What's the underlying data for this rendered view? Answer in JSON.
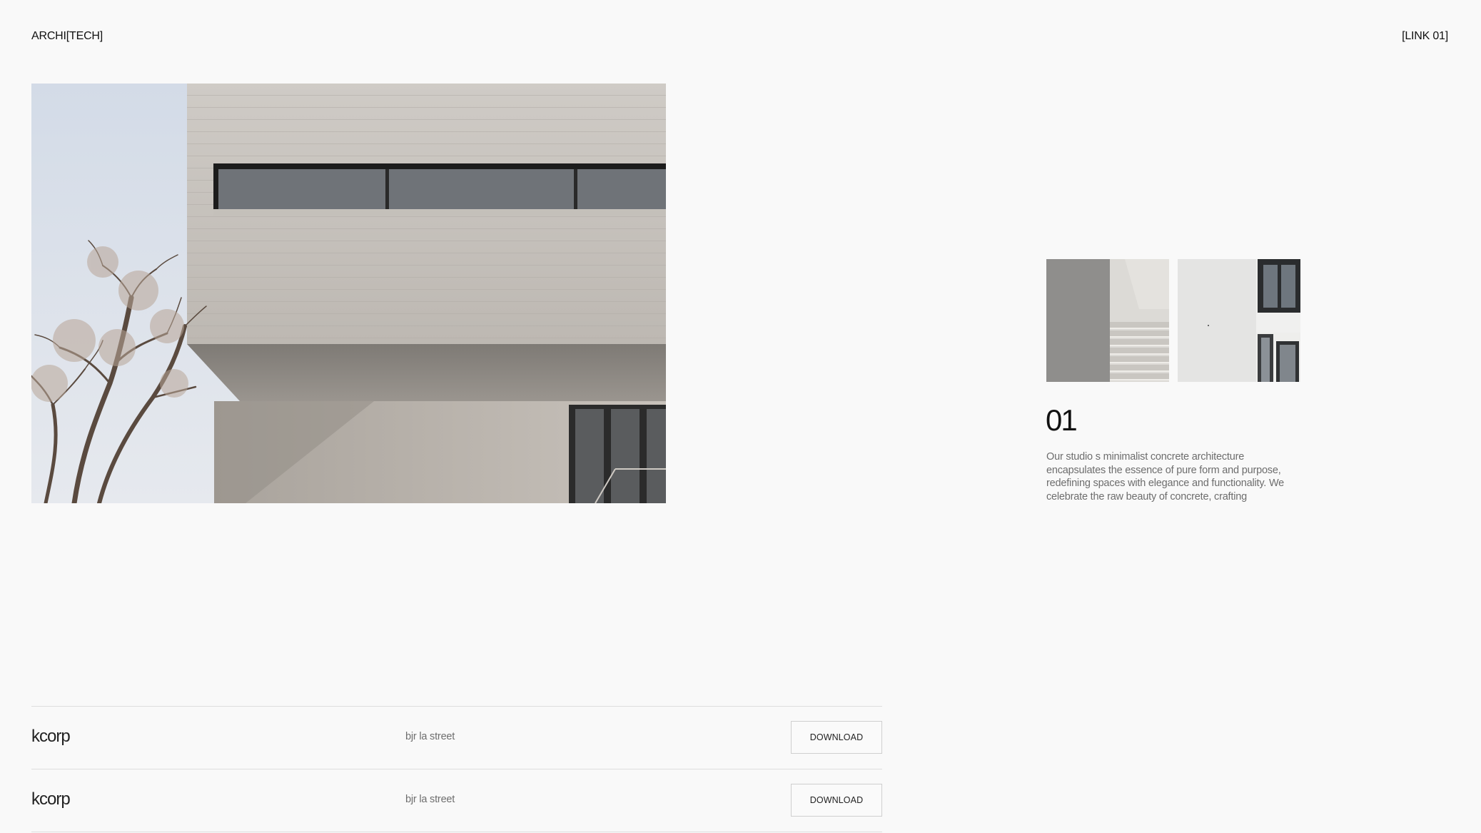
{
  "header": {
    "logo": "ARCHI[TECH]",
    "nav_link": "[LINK 01]"
  },
  "hero": {
    "icon": "architecture-photo"
  },
  "project": {
    "number": "01",
    "description": "Our studio s minimalist concrete architecture encapsulates the essence of pure form and purpose, redefining spaces with elegance and functionality. We celebrate the raw beauty of concrete, crafting"
  },
  "list": {
    "rows": [
      {
        "name": "kcorp",
        "address": "bjr la street",
        "button": "DOWNLOAD"
      },
      {
        "name": "kcorp",
        "address": "bjr la street",
        "button": "DOWNLOAD"
      }
    ]
  }
}
